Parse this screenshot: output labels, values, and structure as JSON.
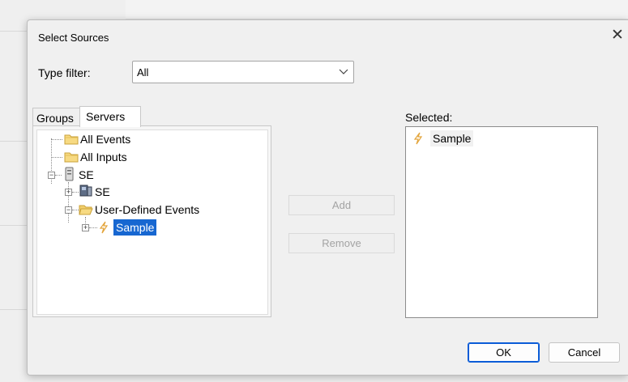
{
  "dialog": {
    "title": "Select Sources",
    "close_glyph": "✕"
  },
  "type_filter": {
    "label": "Type filter:",
    "value": "All"
  },
  "tabs": [
    {
      "label": "Groups",
      "active": false
    },
    {
      "label": "Servers",
      "active": true
    }
  ],
  "tree": {
    "nodes": [
      {
        "label": "All Events",
        "icon": "folder-icon"
      },
      {
        "label": "All Inputs",
        "icon": "folder-icon"
      },
      {
        "label": "SE",
        "icon": "server-icon",
        "expanded": true
      },
      {
        "label": "SE",
        "icon": "computer-icon",
        "expanded": false
      },
      {
        "label": "User-Defined Events",
        "icon": "folder-icon",
        "expanded": true
      },
      {
        "label": "Sample",
        "icon": "event-icon",
        "expanded": false,
        "selected": true
      }
    ]
  },
  "buttons": {
    "add": "Add",
    "remove": "Remove",
    "ok": "OK",
    "cancel": "Cancel"
  },
  "selected": {
    "label": "Selected:",
    "items": [
      {
        "label": "Sample",
        "icon": "event-icon"
      }
    ]
  },
  "colors": {
    "selection": "#1767d1",
    "ok_border": "#0b5cd7",
    "folder": "#f2cf6c",
    "lightning": "#e3a53c"
  }
}
